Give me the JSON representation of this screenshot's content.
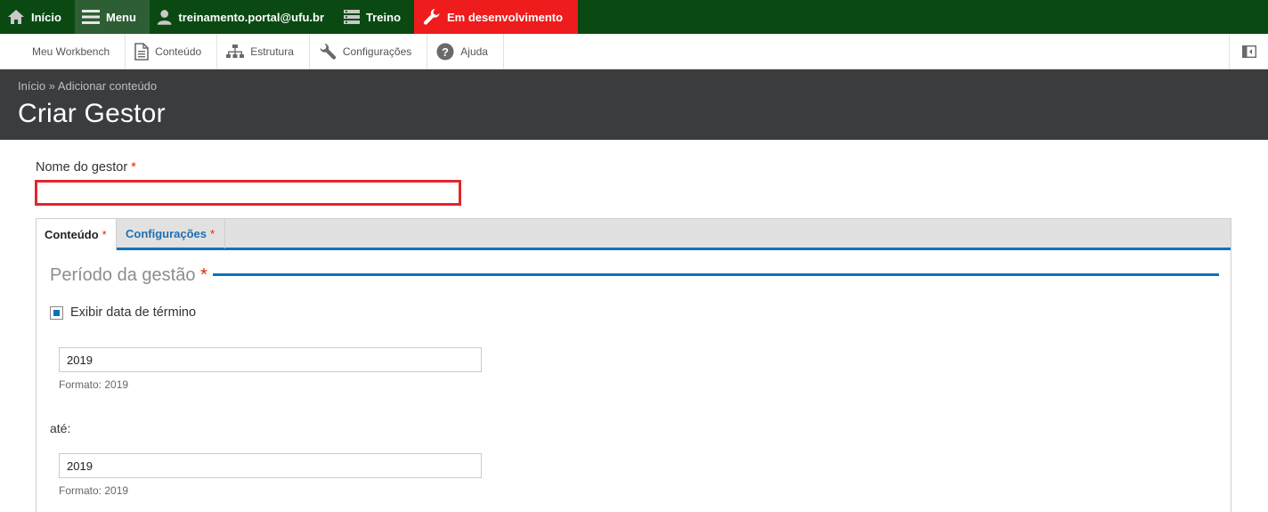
{
  "toolbar": {
    "home_label": "Início",
    "menu_label": "Menu",
    "user_label": "treinamento.portal@ufu.br",
    "treino_label": "Treino",
    "dev_label": "Em desenvolvimento"
  },
  "tray": {
    "items": [
      {
        "label": "Meu Workbench",
        "icon": ""
      },
      {
        "label": "Conteúdo",
        "icon": "document-icon"
      },
      {
        "label": "Estrutura",
        "icon": "sitemap-icon"
      },
      {
        "label": "Configurações",
        "icon": "wrench-icon"
      },
      {
        "label": "Ajuda",
        "icon": "help-icon"
      }
    ]
  },
  "header": {
    "breadcrumb": {
      "home": "Início",
      "separator": "»",
      "current": "Adicionar conteúdo"
    },
    "title": "Criar Gestor"
  },
  "form": {
    "name_label": "Nome do gestor",
    "required_mark": "*",
    "name_value": "",
    "tabs": [
      {
        "label": "Conteúdo",
        "active": true
      },
      {
        "label": "Configurações",
        "active": false
      }
    ],
    "fieldset_legend": "Período da gestão",
    "checkbox_label": "Exibir data de término",
    "checkbox_checked": true,
    "start_year": "2019",
    "start_hint": "Formato: 2019",
    "between_label": "até:",
    "end_year": "2019",
    "end_hint": "Formato: 2019"
  },
  "colors": {
    "toolbar_bg": "#0a4a12",
    "menu_bg": "#2e5e34",
    "dev_bg": "#ee1c1c",
    "header_bg": "#3b3c3e",
    "accent_blue": "#0074bd",
    "error_red": "#e3262b"
  }
}
